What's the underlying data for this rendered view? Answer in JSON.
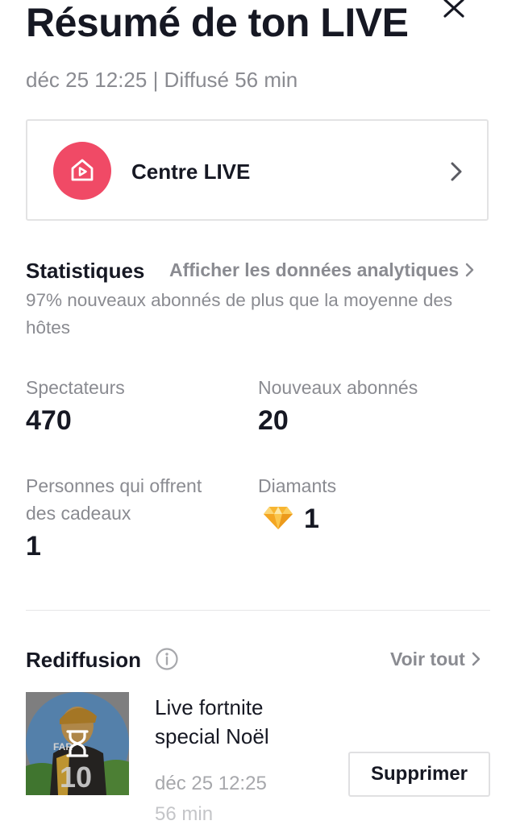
{
  "header": {
    "title": "Résumé de ton LIVE",
    "close_icon": "close-icon",
    "subtitle": "déc 25 12:25 | Diffusé 56 min"
  },
  "live_center": {
    "icon": "live-house-play-icon",
    "label": "Centre LIVE",
    "chevron": "chevron-right-icon",
    "icon_color": "#F04A66"
  },
  "stats": {
    "heading": "Statistiques",
    "analytics_link": "Afficher les données analytiques",
    "note": "97% nouveaux abonnés de plus que la moyenne des hôtes",
    "items": [
      {
        "label": "Spectateurs",
        "value": "470"
      },
      {
        "label": "Nouveaux abonnés",
        "value": "20"
      },
      {
        "label": "Personnes qui offrent des cadeaux",
        "value": "1"
      },
      {
        "label": "Diamants",
        "value": "1",
        "icon": "diamond-icon"
      }
    ]
  },
  "replay": {
    "heading": "Rediffusion",
    "info_icon": "info-icon",
    "see_all": "Voir tout",
    "item": {
      "title": "Live fortnite special Noël",
      "date": "déc 25 12:25",
      "duration": "56 min",
      "thumbnail_icon": "hourglass-icon",
      "delete_label": "Supprimer"
    }
  },
  "colors": {
    "text_primary": "#161823",
    "text_secondary": "#8A8B91",
    "accent": "#F04A66",
    "diamond": "#F5B32A",
    "border": "#E3E3E4"
  }
}
